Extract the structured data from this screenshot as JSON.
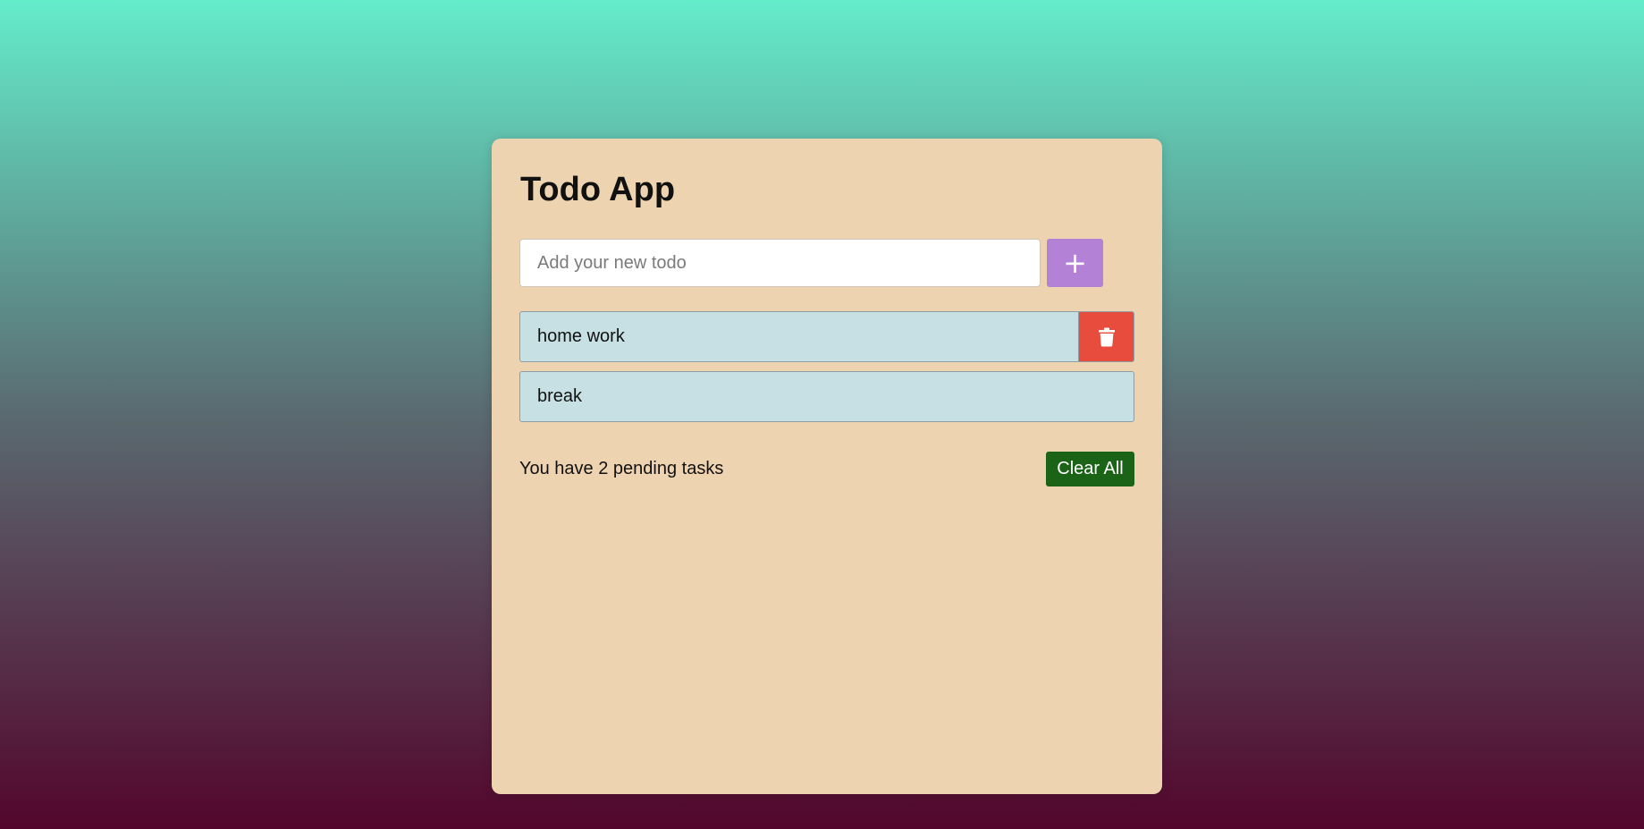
{
  "app": {
    "title": "Todo App"
  },
  "input": {
    "value": "",
    "placeholder": "Add your new todo"
  },
  "add_button": {
    "label": "+",
    "icon": "plus-icon",
    "color": "#b382d6"
  },
  "todos": [
    {
      "text": "home work",
      "delete_icon": "trash-icon",
      "delete_visible": true
    },
    {
      "text": "break",
      "delete_visible": false
    }
  ],
  "footer": {
    "pending_text": "You have 2 pending tasks",
    "clear_label": "Clear All",
    "clear_color": "#1b6316"
  },
  "colors": {
    "card_background": "#edd3b0",
    "item_background": "#c6e0e3",
    "delete_background": "#e84c3d",
    "gradient_top": "#64eccb",
    "gradient_bottom": "#53062c"
  }
}
